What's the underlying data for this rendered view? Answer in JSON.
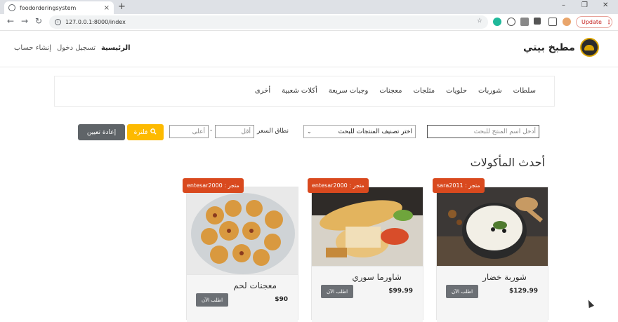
{
  "browser": {
    "tab_title": "foodorderingsystem",
    "tab_close": "×",
    "new_tab": "+",
    "url": "127.0.0.1:8000/index",
    "update_label": "Update"
  },
  "site": {
    "brand": "مطبخ بيتي",
    "nav": {
      "home": "الرئيسية",
      "login": "تسجيل دخول",
      "signup": "إنشاء حساب"
    },
    "categories": [
      "سلطات",
      "شوربات",
      "حلويات",
      "مثلجات",
      "معجنات",
      "وجبات سريعة",
      "أكلات شعبية",
      "أخرى"
    ]
  },
  "filters": {
    "search_placeholder": "أدخل اسم المنتج للبحث",
    "category_select": "اختر تصنيف المنتجات للبحث",
    "price_label": "نطاق السعر",
    "min_placeholder": "أقل",
    "dash": "-",
    "max_placeholder": "أعلى",
    "filter_label": "فلترة",
    "reset_label": "إعادة تعيين"
  },
  "section_title": "أحدث المأكولات",
  "products": [
    {
      "store": "متجر : sara2011",
      "name": "شوربة خضار",
      "price": "$129.99",
      "order": "اطلب الآن"
    },
    {
      "store": "متجر : entesar2000",
      "name": "شاورما سوري",
      "price": "$99.99",
      "order": "اطلب الآن"
    },
    {
      "store": "متجر : entesar2000",
      "name": "معجنات لحم",
      "price": "$90",
      "order": "اطلب الآن"
    }
  ],
  "colors": {
    "badge": "#d9491e",
    "filter_button": "#fdba00",
    "reset_button": "#5f6468"
  }
}
